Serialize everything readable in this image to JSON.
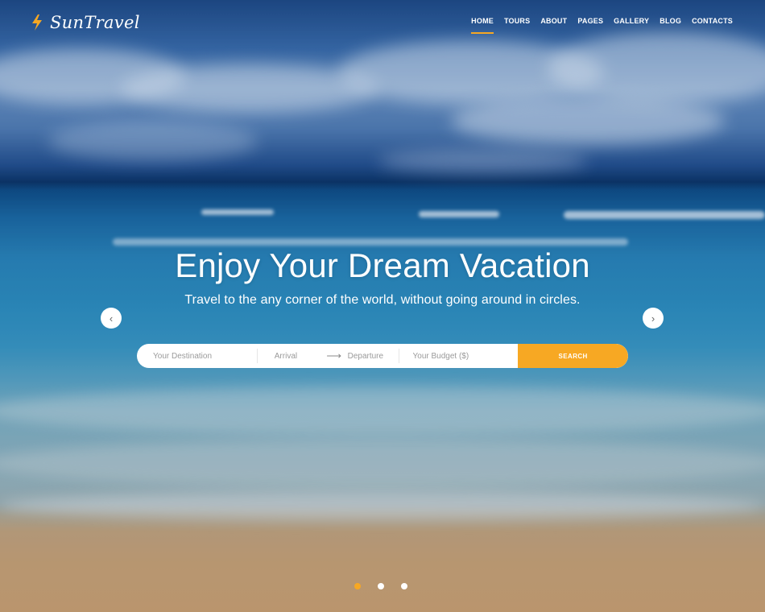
{
  "brand": {
    "name": "SunTravel",
    "accent_color": "#f7a823"
  },
  "nav": {
    "items": [
      {
        "label": "HOME",
        "active": true
      },
      {
        "label": "TOURS",
        "active": false
      },
      {
        "label": "ABOUT",
        "active": false
      },
      {
        "label": "PAGES",
        "active": false
      },
      {
        "label": "GALLERY",
        "active": false
      },
      {
        "label": "BLOG",
        "active": false
      },
      {
        "label": "CONTACTS",
        "active": false
      }
    ]
  },
  "hero": {
    "title": "Enjoy Your Dream Vacation",
    "subtitle": "Travel to the any corner of the world, without going around in circles."
  },
  "slider": {
    "prev_icon": "chevron-left-icon",
    "next_icon": "chevron-right-icon",
    "slide_count": 3,
    "active_slide": 1
  },
  "search": {
    "destination_placeholder": "Your Destination",
    "arrival_placeholder": "Arrival",
    "departure_placeholder": "Departure",
    "budget_placeholder": "Your Budget ($)",
    "button_label": "SEARCH",
    "separator_icon": "arrow-right-icon"
  }
}
